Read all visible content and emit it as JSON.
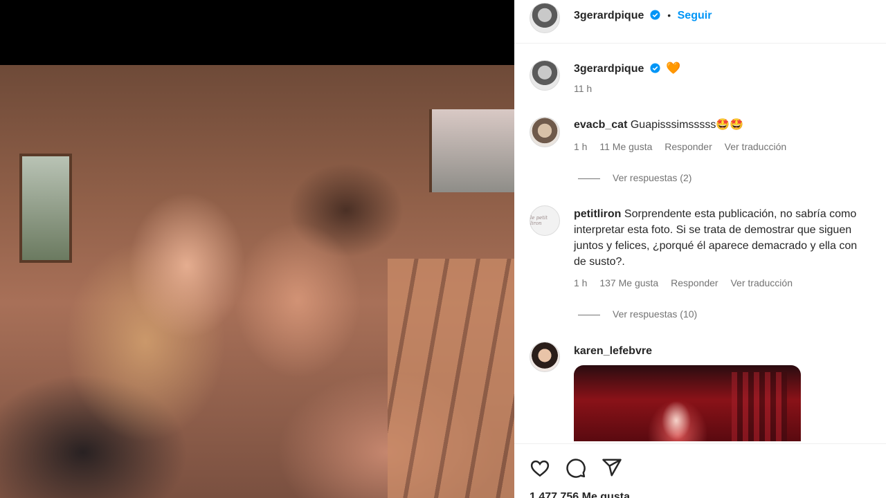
{
  "post": {
    "username": "3gerardpique",
    "follow_label": "Seguir",
    "dot": "•"
  },
  "caption": {
    "username": "3gerardpique",
    "emoji": "🧡",
    "time": "11 h"
  },
  "comments": [
    {
      "username": "evacb_cat",
      "text": "Guapisssimsssss🤩🤩",
      "time": "1 h",
      "likes": "11 Me gusta",
      "reply": "Responder",
      "translate": "Ver traducción",
      "view_replies": "Ver respuestas (2)"
    },
    {
      "username": "petitliron",
      "avatar_text": "le petit liron",
      "text_lines": [
        "Sorprendente esta publicación, no sabría como",
        "interpretar esta foto. Si se trata de demostrar que siguen",
        "juntos y felices, ¿porqué él aparece demacrado y ella con",
        "de susto?."
      ],
      "time": "1 h",
      "likes": "137 Me gusta",
      "reply": "Responder",
      "translate": "Ver traducción",
      "view_replies": "Ver respuestas (10)"
    },
    {
      "username": "karen_lefebvre"
    }
  ],
  "footer": {
    "likes_partial": "1.477.756 Me gusta"
  },
  "icons": {
    "like": "heart-icon",
    "comment": "comment-icon",
    "share": "share-icon",
    "verified": "verified-badge-icon"
  },
  "colors": {
    "link": "#0095f6",
    "verified": "#0095f6",
    "muted": "#737373"
  }
}
